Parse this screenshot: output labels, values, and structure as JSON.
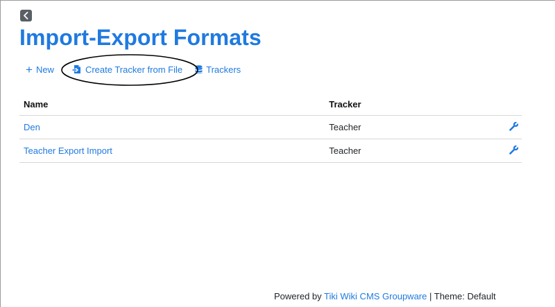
{
  "page": {
    "back_icon": "chevron-left-icon",
    "title": "Import-Export Formats"
  },
  "toolbar": {
    "new_icon": "plus-icon",
    "new_label": "New",
    "create_icon": "file-import-icon",
    "create_label": "Create Tracker from File",
    "trackers_icon": "database-icon",
    "trackers_label": "Trackers"
  },
  "table": {
    "headers": {
      "name": "Name",
      "tracker": "Tracker"
    },
    "rows": [
      {
        "name": "Den",
        "tracker": "Teacher",
        "action_icon": "wrench-icon"
      },
      {
        "name": "Teacher Export Import",
        "tracker": "Teacher",
        "action_icon": "wrench-icon"
      }
    ]
  },
  "footer": {
    "powered_prefix": "Powered by",
    "powered_link": "Tiki Wiki CMS Groupware",
    "theme_text": "| Theme: Default"
  },
  "colors": {
    "link": "#1f7ae0",
    "text": "#212529",
    "annotation_ellipse": "#000000"
  }
}
